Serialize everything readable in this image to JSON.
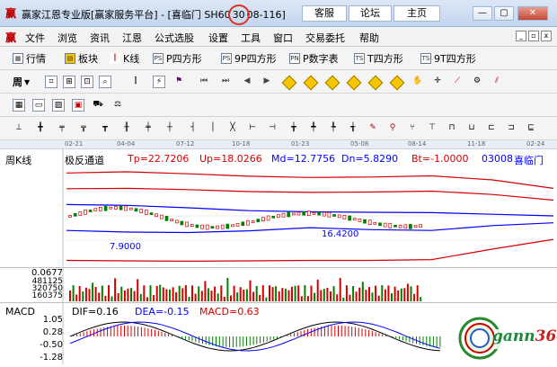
{
  "window": {
    "logo": "赢",
    "title_prefix": "赢家江恩专业版[赢家服务平台] - [喜临门 SH60",
    "title_code_highlight": "30",
    "title_suffix": "08-116]",
    "buttons": [
      "客服",
      "论坛",
      "主页"
    ],
    "controls": {
      "minimize": "—",
      "restore": "▢",
      "close": "✕"
    }
  },
  "menubar": {
    "logo": "赢",
    "items": [
      "文件",
      "浏览",
      "资讯",
      "江恩",
      "公式选股",
      "设置",
      "工具",
      "窗口",
      "交易委托",
      "帮助"
    ],
    "mdi_controls": [
      "_",
      "▫",
      "x"
    ]
  },
  "toolbar1": {
    "items": [
      {
        "label": "行情",
        "icon": "grid-icon"
      },
      {
        "label": "板块",
        "icon": "blocks-icon"
      },
      {
        "label": "K线",
        "icon": "kline-icon"
      },
      {
        "label": "P四方形",
        "icon": "PS"
      },
      {
        "label": "9P四方形",
        "icon": "PS"
      },
      {
        "label": "P数字表",
        "icon": "PN"
      },
      {
        "label": "T四方形",
        "icon": "TS"
      },
      {
        "label": "9T四方形",
        "icon": "TS"
      }
    ]
  },
  "toolbar2": {
    "period_label": "周"
  },
  "datebar": {
    "dates": [
      "02-21",
      "04-04",
      "07-12",
      "10-18",
      "01-23",
      "05-08",
      "08-14",
      "11-18",
      "02-24"
    ]
  },
  "chart": {
    "period_label": "周K线",
    "indicator_name": "极反通道",
    "tp": "Tp=22.7206",
    "up": "Up=18.0266",
    "md": "Md=12.7756",
    "dn": "Dn=5.8290",
    "bt": "Bt=-1.0000",
    "stock_code": "03008",
    "stock_name": "喜临门",
    "price_high_label": "16.4200",
    "price_low_label": "7.9000",
    "volume_labels": [
      "0.0677",
      "481125",
      "320750",
      "160375"
    ],
    "colors": {
      "tp": "#d40000",
      "up": "#d40000",
      "md": "#0000ff",
      "dn": "#0000ff",
      "bt": "#d40000",
      "code": "#0000ff",
      "name": "#0000ff"
    }
  },
  "macd": {
    "label": "MACD",
    "dif": "DIF=0.16",
    "dea": "DEA=-0.15",
    "macd": "MACD=0.63",
    "y_labels": [
      "1.05",
      "0.28",
      "-0.50",
      "-1.28"
    ]
  },
  "watermark": {
    "text": "gann",
    "number": "360"
  },
  "chart_data": {
    "type": "line",
    "title": "",
    "x": [
      "02-21",
      "04-04",
      "07-12",
      "10-18",
      "01-23",
      "05-08",
      "08-14",
      "11-18",
      "02-24"
    ],
    "series": [
      {
        "name": "Tp",
        "values": [
          22.6,
          22.9,
          22.4,
          21.8,
          21.5,
          21.6,
          21.9,
          20.9,
          18.8
        ]
      },
      {
        "name": "Up",
        "values": [
          18.7,
          18.8,
          18.5,
          18.0,
          17.8,
          17.9,
          18.1,
          17.3,
          15.9
        ]
      },
      {
        "name": "Md",
        "values": [
          14.8,
          14.6,
          14.0,
          13.3,
          13.0,
          12.9,
          12.8,
          12.4,
          12.0
        ]
      },
      {
        "name": "Dn",
        "values": [
          8.4,
          8.0,
          7.9,
          8.3,
          9.1,
          8.6,
          8.4,
          9.6,
          10.3
        ]
      },
      {
        "name": "Bt",
        "values": [
          1.0,
          0.9,
          0.8,
          0.9,
          1.0,
          1.0,
          1.2,
          3.8,
          6.2
        ]
      }
    ],
    "ylim": [
      0,
      24
    ]
  }
}
